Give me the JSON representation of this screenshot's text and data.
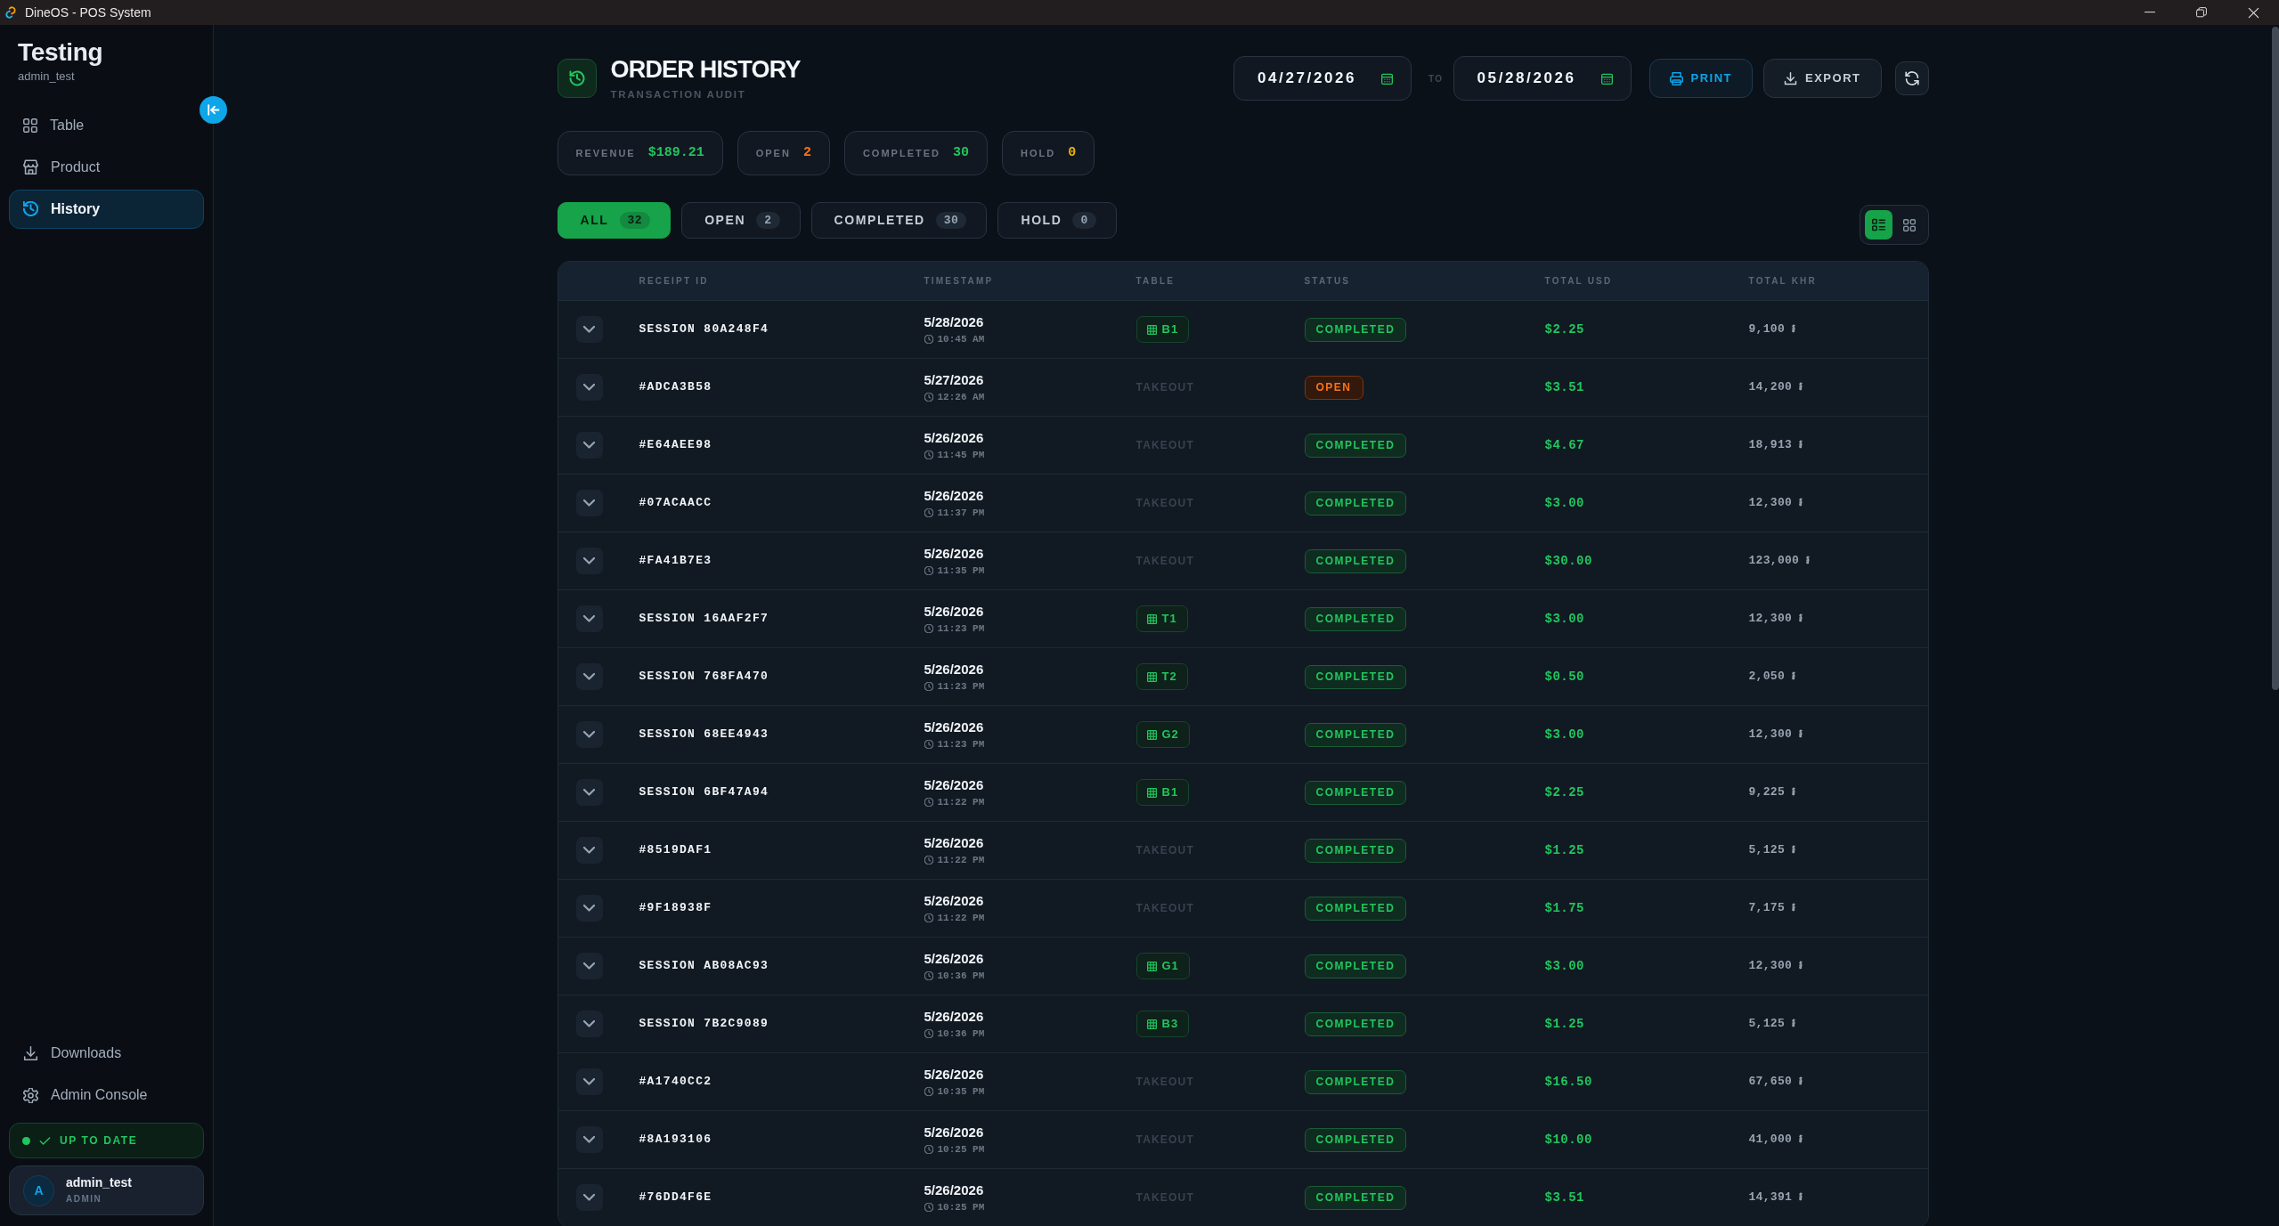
{
  "window": {
    "title": "DineOS - POS System"
  },
  "sidebar": {
    "brand": "Testing",
    "username": "admin_test",
    "nav": [
      {
        "kind": "table",
        "label": "Table",
        "selected": false
      },
      {
        "kind": "product",
        "label": "Product",
        "selected": false
      },
      {
        "kind": "history",
        "label": "History",
        "selected": true
      }
    ],
    "footer_links": [
      {
        "kind": "downloads",
        "label": "Downloads"
      },
      {
        "kind": "settings",
        "label": "Admin Console"
      }
    ],
    "update_status": {
      "label": "UP TO DATE"
    },
    "user": {
      "initial": "A",
      "name": "admin_test",
      "role": "ADMIN"
    }
  },
  "header": {
    "title": "ORDER HISTORY",
    "subtitle": "TRANSACTION AUDIT",
    "date_range": {
      "from": "04/27/2026",
      "separator": "TO",
      "to": "05/28/2026"
    },
    "actions": [
      {
        "kind": "print",
        "label": "PRINT"
      },
      {
        "kind": "export",
        "label": "EXPORT"
      }
    ]
  },
  "stats": [
    {
      "label": "REVENUE",
      "value": "$189.21",
      "color": "#22c55e"
    },
    {
      "label": "OPEN",
      "value": "2",
      "color": "#f97316"
    },
    {
      "label": "COMPLETED",
      "value": "30",
      "color": "#22c55e"
    },
    {
      "label": "HOLD",
      "value": "0",
      "color": "#eab308"
    }
  ],
  "filter_tabs": [
    {
      "label": "ALL",
      "count": "32",
      "selected": true
    },
    {
      "label": "OPEN",
      "count": "2",
      "selected": false
    },
    {
      "label": "COMPLETED",
      "count": "30",
      "selected": false
    },
    {
      "label": "HOLD",
      "count": "0",
      "selected": false
    }
  ],
  "view_modes": [
    {
      "kind": "list",
      "selected": true
    },
    {
      "kind": "grid",
      "selected": false
    }
  ],
  "table": {
    "columns": [
      "RECEIPT ID",
      "TIMESTAMP",
      "TABLE",
      "STATUS",
      "TOTAL USD",
      "TOTAL KHR"
    ],
    "rows": [
      {
        "expanded": false,
        "receipt": "SESSION 80A248F4",
        "date": "5/28/2026",
        "time": "10:45 AM",
        "table": {
          "kind": "dine_in",
          "text": "B1"
        },
        "status": {
          "kind": "completed",
          "text": "COMPLETED"
        },
        "usd": "$2.25",
        "khr": "9,100 ៛"
      },
      {
        "expanded": false,
        "receipt": "#ADCA3B58",
        "date": "5/27/2026",
        "time": "12:26 AM",
        "table": {
          "kind": "takeout",
          "text": "TAKEOUT"
        },
        "status": {
          "kind": "open",
          "text": "OPEN"
        },
        "usd": "$3.51",
        "khr": "14,200 ៛"
      },
      {
        "expanded": false,
        "receipt": "#E64AEE98",
        "date": "5/26/2026",
        "time": "11:45 PM",
        "table": {
          "kind": "takeout",
          "text": "TAKEOUT"
        },
        "status": {
          "kind": "completed",
          "text": "COMPLETED"
        },
        "usd": "$4.67",
        "khr": "18,913 ៛"
      },
      {
        "expanded": false,
        "receipt": "#07ACAACC",
        "date": "5/26/2026",
        "time": "11:37 PM",
        "table": {
          "kind": "takeout",
          "text": "TAKEOUT"
        },
        "status": {
          "kind": "completed",
          "text": "COMPLETED"
        },
        "usd": "$3.00",
        "khr": "12,300 ៛"
      },
      {
        "expanded": false,
        "receipt": "#FA41B7E3",
        "date": "5/26/2026",
        "time": "11:35 PM",
        "table": {
          "kind": "takeout",
          "text": "TAKEOUT"
        },
        "status": {
          "kind": "completed",
          "text": "COMPLETED"
        },
        "usd": "$30.00",
        "khr": "123,000 ៛"
      },
      {
        "expanded": false,
        "receipt": "SESSION 16AAF2F7",
        "date": "5/26/2026",
        "time": "11:23 PM",
        "table": {
          "kind": "dine_in",
          "text": "T1"
        },
        "status": {
          "kind": "completed",
          "text": "COMPLETED"
        },
        "usd": "$3.00",
        "khr": "12,300 ៛"
      },
      {
        "expanded": false,
        "receipt": "SESSION 768FA470",
        "date": "5/26/2026",
        "time": "11:23 PM",
        "table": {
          "kind": "dine_in",
          "text": "T2"
        },
        "status": {
          "kind": "completed",
          "text": "COMPLETED"
        },
        "usd": "$0.50",
        "khr": "2,050 ៛"
      },
      {
        "expanded": false,
        "receipt": "SESSION 68EE4943",
        "date": "5/26/2026",
        "time": "11:23 PM",
        "table": {
          "kind": "dine_in",
          "text": "G2"
        },
        "status": {
          "kind": "completed",
          "text": "COMPLETED"
        },
        "usd": "$3.00",
        "khr": "12,300 ៛"
      },
      {
        "expanded": false,
        "receipt": "SESSION 6BF47A94",
        "date": "5/26/2026",
        "time": "11:22 PM",
        "table": {
          "kind": "dine_in",
          "text": "B1"
        },
        "status": {
          "kind": "completed",
          "text": "COMPLETED"
        },
        "usd": "$2.25",
        "khr": "9,225 ៛"
      },
      {
        "expanded": false,
        "receipt": "#8519DAF1",
        "date": "5/26/2026",
        "time": "11:22 PM",
        "table": {
          "kind": "takeout",
          "text": "TAKEOUT"
        },
        "status": {
          "kind": "completed",
          "text": "COMPLETED"
        },
        "usd": "$1.25",
        "khr": "5,125 ៛"
      },
      {
        "expanded": false,
        "receipt": "#9F18938F",
        "date": "5/26/2026",
        "time": "11:22 PM",
        "table": {
          "kind": "takeout",
          "text": "TAKEOUT"
        },
        "status": {
          "kind": "completed",
          "text": "COMPLETED"
        },
        "usd": "$1.75",
        "khr": "7,175 ៛"
      },
      {
        "expanded": false,
        "receipt": "SESSION AB08AC93",
        "date": "5/26/2026",
        "time": "10:36 PM",
        "table": {
          "kind": "dine_in",
          "text": "G1"
        },
        "status": {
          "kind": "completed",
          "text": "COMPLETED"
        },
        "usd": "$3.00",
        "khr": "12,300 ៛"
      },
      {
        "expanded": false,
        "receipt": "SESSION 7B2C9089",
        "date": "5/26/2026",
        "time": "10:36 PM",
        "table": {
          "kind": "dine_in",
          "text": "B3"
        },
        "status": {
          "kind": "completed",
          "text": "COMPLETED"
        },
        "usd": "$1.25",
        "khr": "5,125 ៛"
      },
      {
        "expanded": false,
        "receipt": "#A1740CC2",
        "date": "5/26/2026",
        "time": "10:35 PM",
        "table": {
          "kind": "takeout",
          "text": "TAKEOUT"
        },
        "status": {
          "kind": "completed",
          "text": "COMPLETED"
        },
        "usd": "$16.50",
        "khr": "67,650 ៛"
      },
      {
        "expanded": false,
        "receipt": "#8A193106",
        "date": "5/26/2026",
        "time": "10:25 PM",
        "table": {
          "kind": "takeout",
          "text": "TAKEOUT"
        },
        "status": {
          "kind": "completed",
          "text": "COMPLETED"
        },
        "usd": "$10.00",
        "khr": "41,000 ៛"
      },
      {
        "expanded": false,
        "receipt": "#76DD4F6E",
        "date": "5/26/2026",
        "time": "10:25 PM",
        "table": {
          "kind": "takeout",
          "text": "TAKEOUT"
        },
        "status": {
          "kind": "completed",
          "text": "COMPLETED"
        },
        "usd": "$3.51",
        "khr": "14,391 ៛"
      }
    ]
  }
}
